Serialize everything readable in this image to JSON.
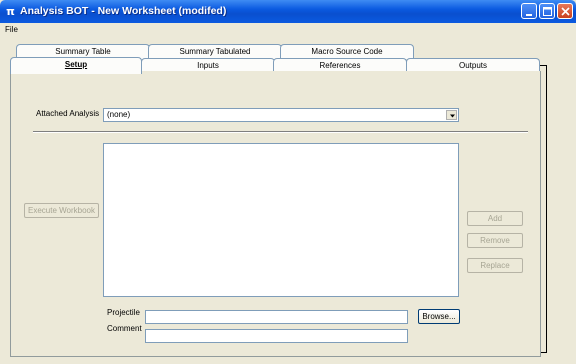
{
  "window": {
    "title": "Analysis BOT - New Worksheet (modifed)",
    "icon": "app-icon",
    "icon_glyph": "π"
  },
  "menu": {
    "file": "File"
  },
  "tabs_back": [
    "Summary Table",
    "Summary Tabulated",
    "Macro Source Code"
  ],
  "tabs_front": [
    "Setup",
    "Inputs",
    "References",
    "Outputs"
  ],
  "setup": {
    "attached_analysis_label": "Attached Analysis",
    "attached_analysis_value": "(none)",
    "execute_button": "Execute Workbook",
    "add_button": "Add",
    "remove_button": "Remove",
    "replace_button": "Replace",
    "projectfile_label": "Projectile",
    "comment_label": "Comment",
    "browse_button": "Browse...",
    "projectfile_value": "",
    "comment_value": ""
  }
}
